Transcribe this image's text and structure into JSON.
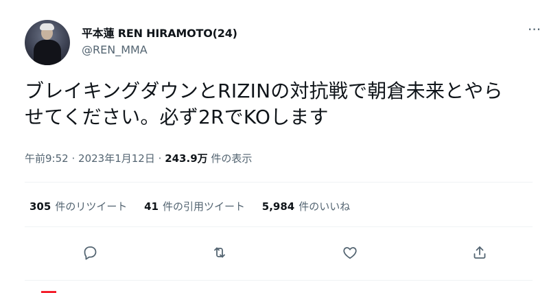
{
  "author": {
    "display_name": "平本蓮 REN HIRAMOTO(24)",
    "handle": "@REN_MMA"
  },
  "menu": {
    "more_icon": "more-icon"
  },
  "tweet": {
    "text_line1": "ブレイキングダウンとRIZINの対抗戦で朝倉未来とやら",
    "text_line2": "せてください。必ず2RでKOします"
  },
  "meta": {
    "time": "午前9:52",
    "sep1": "·",
    "date": "2023年1月12日",
    "sep2": "·",
    "views": "243.9万",
    "views_label": "件の表示"
  },
  "stats": {
    "retweets": {
      "count": "305",
      "label": "件のリツイート"
    },
    "quotes": {
      "count": "41",
      "label": "件の引用ツイート"
    },
    "likes": {
      "count": "5,984",
      "label": "件のいいね"
    }
  },
  "actions": [
    {
      "icon": "reply-icon"
    },
    {
      "icon": "retweet-icon"
    },
    {
      "icon": "like-icon"
    },
    {
      "icon": "share-icon"
    }
  ],
  "colors": {
    "text": "#0f1419",
    "secondary": "#536471",
    "divider": "#eff3f4"
  }
}
